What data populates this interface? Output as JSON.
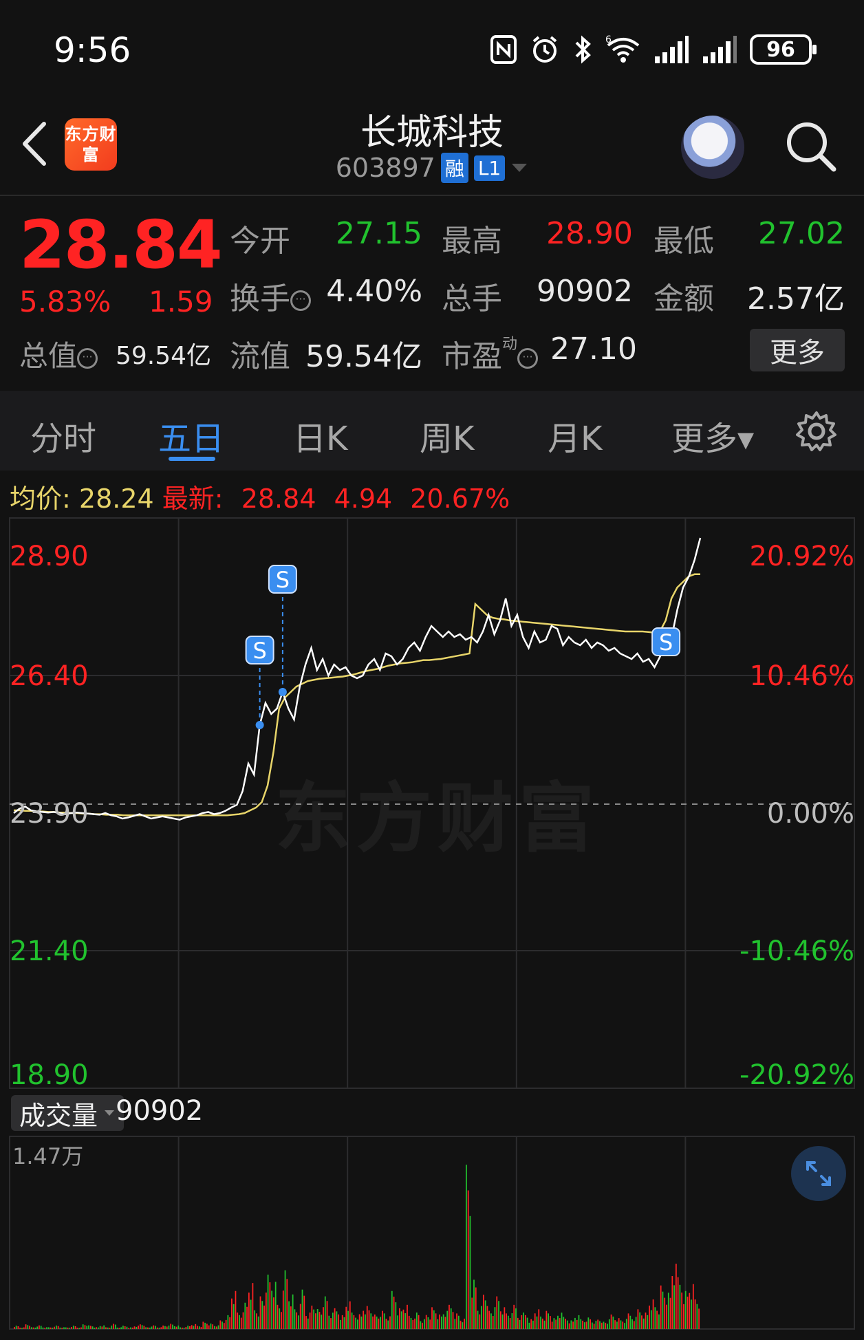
{
  "status_bar": {
    "time": "9:56",
    "battery": "96",
    "network_label": "6"
  },
  "header": {
    "app_logo_text": "东方财富",
    "stock_name": "长城科技",
    "stock_code": "603897",
    "tag_margin": "融",
    "tag_level": "L1",
    "icons": [
      "back-arrow-icon",
      "robot-avatar-icon",
      "search-icon"
    ]
  },
  "quote": {
    "price": "28.84",
    "change_pct": "5.83%",
    "change_amt": "1.59",
    "total_value_label": "总值",
    "total_value": "59.54亿",
    "open_label": "今开",
    "open": "27.15",
    "high_label": "最高",
    "high": "28.90",
    "low_label": "最低",
    "low": "27.02",
    "turnover_label": "换手",
    "turnover": "4.40%",
    "volume_label": "总手",
    "volume": "90902",
    "amount_label": "金额",
    "amount": "2.57亿",
    "float_value_label": "流值",
    "float_value": "59.54亿",
    "pe_label": "市盈",
    "pe_sup": "动",
    "pe": "27.10",
    "more_label": "更多"
  },
  "tabs": [
    {
      "label": "分时",
      "active": false
    },
    {
      "label": "五日",
      "active": true
    },
    {
      "label": "日K",
      "active": false
    },
    {
      "label": "周K",
      "active": false
    },
    {
      "label": "月K",
      "active": false
    },
    {
      "label": "更多▾",
      "active": false
    }
  ],
  "chart_info": {
    "avg_label": "均价:",
    "avg_value": "28.24",
    "latest_label": "最新:",
    "latest_value": "28.84",
    "latest_change": "4.94",
    "latest_pct": "20.67%"
  },
  "colors": {
    "up": "#ff2323",
    "down": "#21c22e",
    "price_line": "#ffffff",
    "avg_line": "#e8d56a",
    "accent": "#3a8ef0"
  },
  "chart_data": {
    "type": "line",
    "title": "",
    "left_axis_ticks": [
      "28.90",
      "26.40",
      "23.90",
      "21.40",
      "18.90"
    ],
    "right_axis_ticks": [
      "20.92%",
      "10.46%",
      "0.00%",
      "-10.46%",
      "-20.92%"
    ],
    "ylim": [
      18.9,
      28.9
    ],
    "prev_close": 23.9,
    "days": 5,
    "series": [
      {
        "name": "price",
        "values": [
          23.9,
          23.98,
          24.02,
          23.95,
          23.93,
          23.92,
          23.91,
          23.92,
          23.9,
          23.88,
          23.9,
          23.91,
          23.9,
          23.89,
          23.88,
          23.87,
          23.9,
          23.86,
          23.84,
          23.8,
          23.82,
          23.85,
          23.88,
          23.84,
          23.8,
          23.82,
          23.84,
          23.82,
          23.8,
          23.78,
          23.82,
          23.84,
          23.86,
          23.9,
          23.92,
          23.88,
          23.9,
          23.94,
          24.0,
          24.05,
          24.3,
          24.8,
          24.6,
          25.5,
          25.9,
          25.7,
          25.8,
          26.1,
          25.8,
          25.6,
          26.2,
          26.6,
          26.9,
          26.5,
          26.7,
          26.4,
          26.6,
          26.5,
          26.55,
          26.4,
          26.35,
          26.4,
          26.6,
          26.7,
          26.5,
          26.8,
          26.75,
          26.6,
          26.7,
          26.9,
          27.0,
          26.85,
          27.1,
          27.3,
          27.2,
          27.1,
          27.2,
          27.1,
          27.15,
          27.05,
          27.1,
          27.0,
          27.2,
          27.5,
          27.15,
          27.4,
          27.8,
          27.3,
          27.5,
          27.1,
          26.9,
          27.2,
          27.0,
          27.05,
          27.3,
          27.25,
          26.95,
          27.1,
          27.0,
          26.95,
          27.05,
          26.9,
          27.0,
          26.95,
          26.85,
          26.9,
          26.8,
          26.75,
          26.7,
          26.8,
          26.65,
          26.7,
          26.55,
          26.75,
          27.02,
          27.1,
          27.6,
          28.0,
          28.2,
          28.5,
          28.9
        ]
      },
      {
        "name": "avg",
        "values": [
          23.95,
          23.95,
          23.94,
          23.94,
          23.93,
          23.93,
          23.92,
          23.92,
          23.91,
          23.91,
          23.9,
          23.9,
          23.89,
          23.89,
          23.88,
          23.88,
          23.87,
          23.87,
          23.87,
          23.86,
          23.86,
          23.86,
          23.86,
          23.86,
          23.86,
          23.86,
          23.86,
          23.86,
          23.86,
          23.86,
          23.86,
          23.86,
          23.86,
          23.86,
          23.86,
          23.86,
          23.86,
          23.86,
          23.87,
          23.88,
          23.9,
          23.95,
          24.0,
          24.1,
          24.4,
          25.0,
          25.8,
          26.0,
          26.1,
          26.2,
          26.25,
          26.3,
          26.32,
          26.34,
          26.35,
          26.36,
          26.37,
          26.38,
          26.4,
          26.42,
          26.45,
          26.48,
          26.5,
          26.52,
          26.55,
          26.58,
          26.6,
          26.62,
          26.63,
          26.64,
          26.66,
          26.68,
          26.68,
          26.69,
          26.7,
          26.72,
          26.74,
          26.76,
          26.78,
          26.8,
          27.7,
          27.6,
          27.5,
          27.45,
          27.43,
          27.42,
          27.4,
          27.39,
          27.38,
          27.37,
          27.36,
          27.35,
          27.34,
          27.33,
          27.32,
          27.31,
          27.3,
          27.29,
          27.28,
          27.27,
          27.26,
          27.25,
          27.24,
          27.23,
          27.22,
          27.21,
          27.2,
          27.2,
          27.2,
          27.2,
          27.19,
          27.18,
          27.2,
          27.4,
          27.8,
          28.0,
          28.1,
          28.2,
          28.24,
          28.24
        ]
      }
    ],
    "trade_markers": [
      "S",
      "S",
      "S"
    ],
    "volume_label": "成交量",
    "volume_total": "90902",
    "volume_max_label": "1.47万",
    "volume_values": [
      2,
      1,
      3,
      1,
      2,
      1,
      1,
      2,
      1,
      1,
      2,
      1,
      3,
      2,
      1,
      2,
      1,
      3,
      1,
      2,
      1,
      2,
      3,
      1,
      2,
      1,
      2,
      3,
      2,
      1,
      2,
      3,
      2,
      4,
      3,
      2,
      5,
      8,
      22,
      10,
      16,
      28,
      12,
      18,
      30,
      26,
      14,
      34,
      20,
      12,
      24,
      10,
      15,
      11,
      18,
      9,
      12,
      8,
      16,
      10,
      9,
      14,
      12,
      8,
      10,
      7,
      22,
      12,
      14,
      8,
      10,
      6,
      9,
      12,
      8,
      10,
      14,
      9,
      6,
      100,
      30,
      14,
      22,
      10,
      18,
      12,
      9,
      14,
      8,
      10,
      6,
      12,
      8,
      10,
      6,
      9,
      7,
      5,
      8,
      6,
      7,
      5,
      6,
      4,
      8,
      6,
      5,
      9,
      7,
      12,
      10,
      18,
      14,
      24,
      20,
      36,
      30,
      22,
      26,
      18
    ]
  }
}
